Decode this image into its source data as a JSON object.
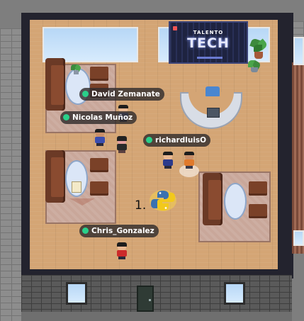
{
  "poster": {
    "line1": "TALENTO",
    "line2": "TECH"
  },
  "players": [
    {
      "name": "David Zemanate",
      "online": true
    },
    {
      "name": "Nicolas Muñoz",
      "online": true
    },
    {
      "name": "richardluisO",
      "online": true
    },
    {
      "name": "Chris_Gonzalez",
      "online": true
    }
  ],
  "floor_label": "1.",
  "colors": {
    "status_online": "#2ad08a",
    "poster_bg": "#1e2340",
    "sofa": "#6b3a26",
    "floor": "#d4a575"
  },
  "icons": [
    "python-logo-icon",
    "plant-icon",
    "desk-computer-icon",
    "door-icon"
  ]
}
